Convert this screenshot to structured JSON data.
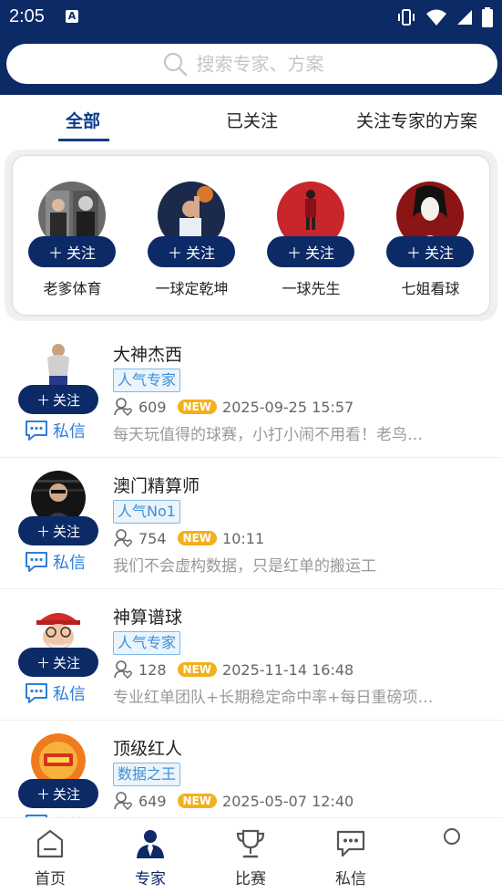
{
  "status": {
    "time": "2:05"
  },
  "search": {
    "placeholder": "搜索专家、方案"
  },
  "tabs": [
    {
      "label": "全部",
      "active": true
    },
    {
      "label": "已关注",
      "active": false
    },
    {
      "label": "关注专家的方案",
      "active": false
    }
  ],
  "recommended": [
    {
      "name": "老爹体育",
      "follow_label": "关注"
    },
    {
      "name": "一球定乾坤",
      "follow_label": "关注"
    },
    {
      "name": "一球先生",
      "follow_label": "关注"
    },
    {
      "name": "七姐看球",
      "follow_label": "关注"
    }
  ],
  "experts": [
    {
      "name": "大神杰西",
      "tag": "人气专家",
      "followers": "609",
      "new_badge": "NEW",
      "time": "2025-09-25 15:57",
      "desc": "每天玩值得的球赛，小打小闹不用看！老鸟…",
      "follow_label": "关注",
      "msg_label": "私信"
    },
    {
      "name": "澳门精算师",
      "tag": "人气No1",
      "followers": "754",
      "new_badge": "NEW",
      "time": "10:11",
      "desc": "我们不会虚构数据，只是红单的搬运工",
      "follow_label": "关注",
      "msg_label": "私信"
    },
    {
      "name": "神算谱球",
      "tag": "人气专家",
      "followers": "128",
      "new_badge": "NEW",
      "time": "2025-11-14 16:48",
      "desc": "专业红单团队+长期稳定命中率+每日重磅项…",
      "follow_label": "关注",
      "msg_label": "私信"
    },
    {
      "name": "顶级红人",
      "tag": "数据之王",
      "followers": "649",
      "new_badge": "NEW",
      "time": "2025-05-07 12:40",
      "desc": "",
      "follow_label": "关注",
      "msg_label": "私信"
    }
  ],
  "bottom_nav": [
    {
      "label": "首页",
      "icon": "home-icon",
      "active": false
    },
    {
      "label": "专家",
      "icon": "expert-icon",
      "active": true
    },
    {
      "label": "比赛",
      "icon": "trophy-icon",
      "active": false
    },
    {
      "label": "私信",
      "icon": "message-icon",
      "active": false
    }
  ],
  "colors": {
    "primary": "#0b2a66",
    "accent_blue": "#2e7fd6",
    "new_badge": "#f2b01e"
  }
}
